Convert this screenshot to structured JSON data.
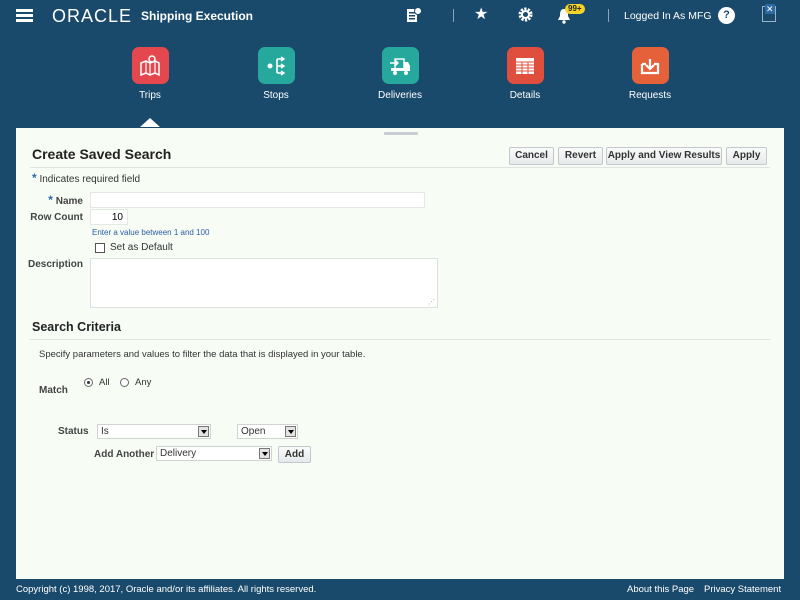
{
  "header": {
    "logo": "ORACLE",
    "app_title": "Shipping Execution",
    "notification_count": "99+",
    "logged_in_text": "Logged In As MFG",
    "help_glyph": "?",
    "icons": [
      "menu-icon",
      "recent-items-icon",
      "favorites-star-icon",
      "settings-gear-icon",
      "notifications-bell-icon",
      "help-icon",
      "sign-out-icon"
    ]
  },
  "nav": {
    "items": [
      {
        "label": "Trips",
        "icon": "map-pin-icon",
        "color": "#e4474d",
        "selected": true
      },
      {
        "label": "Stops",
        "icon": "branch-arrows-icon",
        "color": "#26a99c"
      },
      {
        "label": "Deliveries",
        "icon": "delivery-truck-icon",
        "color": "#26a99c"
      },
      {
        "label": "Details",
        "icon": "table-grid-icon",
        "color": "#e04f3d"
      },
      {
        "label": "Requests",
        "icon": "inbox-download-icon",
        "color": "#e5613a"
      }
    ]
  },
  "form": {
    "title": "Create Saved Search",
    "buttons": {
      "cancel": "Cancel",
      "revert": "Revert",
      "apply_view": "Apply and View Results",
      "apply": "Apply"
    },
    "required_marker": "*",
    "required_note": "Indicates required field",
    "name_label": "Name",
    "name_value": "",
    "row_count_label": "Row Count",
    "row_count_value": "10",
    "row_count_hint": "Enter a value between 1 and 100",
    "default_label": "Set as Default",
    "default_checked": false,
    "description_label": "Description",
    "description_value": ""
  },
  "criteria": {
    "title": "Search Criteria",
    "description": "Specify parameters and values to filter the data that is displayed in your table.",
    "match_label": "Match",
    "match_options": [
      "All",
      "Any"
    ],
    "match_selected": "All",
    "status_label": "Status",
    "status_operator": "Is",
    "status_value": "Open",
    "add_another_label": "Add Another",
    "add_another_value": "Delivery",
    "add_button": "Add"
  },
  "footer": {
    "copyright": "Copyright (c) 1998, 2017, Oracle and/or its affiliates. All rights reserved.",
    "about": "About this Page",
    "privacy": "Privacy Statement"
  }
}
